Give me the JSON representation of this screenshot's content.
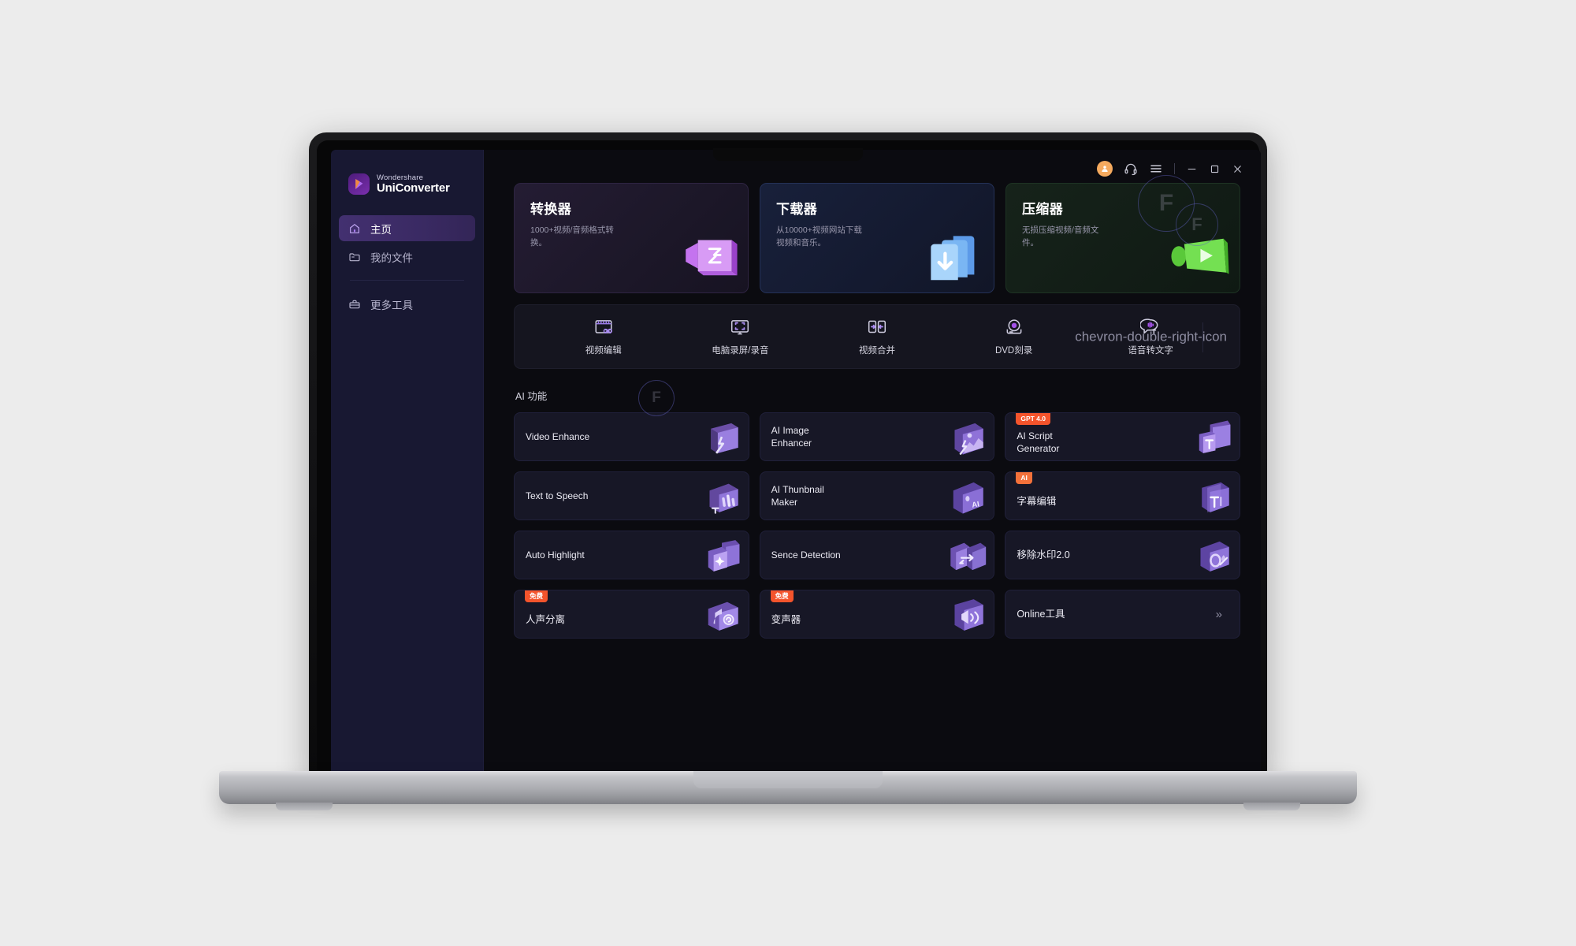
{
  "app": {
    "brand_top": "Wondershare",
    "brand_bottom": "UniConverter",
    "logo_icon": "uniconverter-play-logo"
  },
  "titlebar": {
    "avatar_icon": "user-avatar-icon",
    "support_icon": "headset-icon",
    "menu_icon": "hamburger-menu-icon",
    "minimize_icon": "minimize-icon",
    "maximize_icon": "maximize-icon",
    "close_icon": "close-icon"
  },
  "watermark": {
    "glyph_1": "F",
    "glyph_2": "F",
    "glyph_3": "F"
  },
  "sidebar": {
    "items": [
      {
        "label": "主页",
        "icon": "home-icon",
        "active": true
      },
      {
        "label": "我的文件",
        "icon": "folder-icon",
        "active": false
      },
      {
        "label": "更多工具",
        "icon": "toolbox-icon",
        "active": false
      }
    ]
  },
  "hero_cards": [
    {
      "title": "转换器",
      "desc": "1000+视频/音频格式转换。",
      "icon": "converter-icon",
      "accent": "#c06ae8"
    },
    {
      "title": "下载器",
      "desc": "从10000+视频网站下载视频和音乐。",
      "icon": "downloader-icon",
      "accent": "#5aa7f5"
    },
    {
      "title": "压缩器",
      "desc": "无损压缩视频/音频文件。",
      "icon": "compressor-icon",
      "accent": "#62d94a"
    }
  ],
  "toolstrip": {
    "tools": [
      {
        "label": "视频编辑",
        "icon": "video-edit-icon"
      },
      {
        "label": "电脑录屏/录音",
        "icon": "screen-record-icon"
      },
      {
        "label": "视频合并",
        "icon": "video-merge-icon"
      },
      {
        "label": "DVD刻录",
        "icon": "dvd-burn-icon"
      },
      {
        "label": "语音转文字",
        "icon": "speech-to-text-icon"
      }
    ],
    "more_icon": "chevron-double-right-icon"
  },
  "ai_section": {
    "heading": "AI 功能",
    "cards": [
      {
        "label": "Video Enhance",
        "badge": null,
        "icon": "video-enhance-icon"
      },
      {
        "label": "AI Image Enhancer",
        "badge": null,
        "icon": "image-enhance-icon"
      },
      {
        "label": "AI Script Generator",
        "badge": "GPT 4.0",
        "icon": "script-generator-icon"
      },
      {
        "label": "Text to Speech",
        "badge": null,
        "icon": "text-to-speech-icon"
      },
      {
        "label": "AI Thunbnail Maker",
        "badge": null,
        "icon": "thumbnail-maker-icon"
      },
      {
        "label": "字幕编辑",
        "badge": "AI",
        "icon": "subtitle-edit-icon"
      },
      {
        "label": "Auto Highlight",
        "badge": null,
        "icon": "auto-highlight-icon"
      },
      {
        "label": "Sence Detection",
        "badge": null,
        "icon": "scene-detection-icon"
      },
      {
        "label": "移除水印2.0",
        "badge": null,
        "icon": "remove-watermark-icon"
      },
      {
        "label": "人声分离",
        "badge": "免费",
        "icon": "vocal-remover-icon"
      },
      {
        "label": "变声器",
        "badge": "免费",
        "icon": "voice-changer-icon"
      },
      {
        "label": "Online工具",
        "badge": null,
        "icon": "online-tools-icon",
        "more": "»"
      }
    ]
  },
  "colors": {
    "sidebar_bg": "#181832",
    "main_bg": "#0b0b10",
    "accent_purple": "#7a2fae",
    "badge_red": "#f4542c",
    "badge_orange": "#f4713a",
    "avatar_orange": "#f5aa5e"
  }
}
